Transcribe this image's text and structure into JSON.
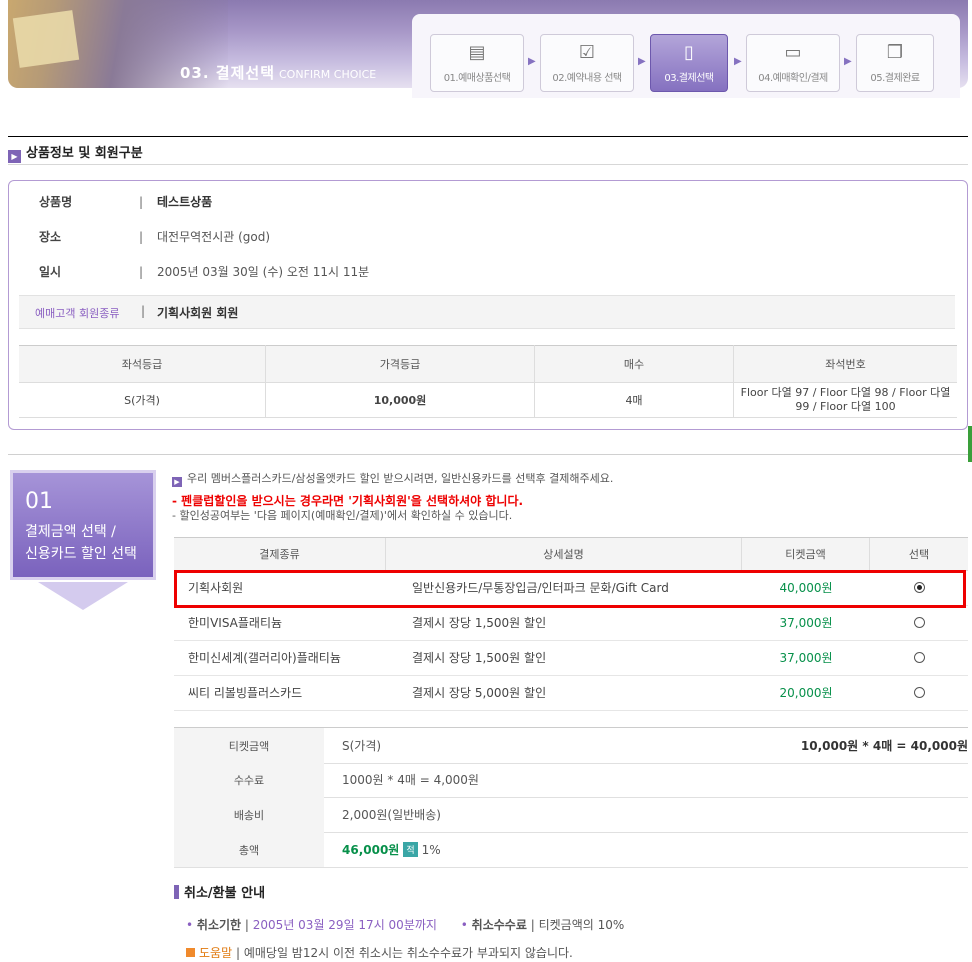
{
  "header": {
    "title": "03. 결제선택",
    "subtitle": "CONFIRM CHOICE",
    "steps": [
      {
        "label": "01.예매상품선택",
        "icon": "doc-list-icon"
      },
      {
        "label": "02.예약내용 선택",
        "icon": "checklist-icon"
      },
      {
        "label": "03.결제선택",
        "icon": "phone-icon"
      },
      {
        "label": "04.예매확인/결제",
        "icon": "card-icon"
      },
      {
        "label": "05.결제완료",
        "icon": "gift-icon"
      }
    ]
  },
  "product_section": {
    "title": "상품정보 및 회원구분",
    "fields": [
      {
        "key": "상품명",
        "value": "테스트상품"
      },
      {
        "key": "장소",
        "value": "대전무역전시관 (god)"
      },
      {
        "key": "일시",
        "value": "2005년 03월 30일 (수) 오전 11시 11분"
      }
    ],
    "member_label": "예매고객 회원종류",
    "member_value": "기획사회원 회원",
    "seat_table": {
      "headers": [
        "좌석등급",
        "가격등급",
        "매수",
        "좌석번호"
      ],
      "row": [
        "S(가격)",
        "10,000원",
        "4매",
        "Floor 다열 97 / Floor 다열 98 / Floor 다열 99 / Floor 다열 100"
      ]
    }
  },
  "payment_section": {
    "badge": {
      "num": "01",
      "line1": "결제금액 선택 /",
      "line2": "신용카드 할인 선택"
    },
    "notice1": "우리 멤버스플러스카드/삼성올앳카드 할인 받으시려면, 일반신용카드를 선택후 결제해주세요.",
    "notice2": "- 펜클럽할인을 받으시는 경우라면 '기획사회원'을 선택하셔야 합니다.",
    "notice3": "- 할인성공여부는 '다음 페이지(예매확인/결제)'에서 확인하실 수 있습니다.",
    "headers": [
      "결제종류",
      "상세설명",
      "티켓금액",
      "선택"
    ],
    "rows": [
      {
        "type": "기획사회원",
        "desc": "일반신용카드/무통장입금/인터파크 문화/Gift Card",
        "amount": "40,000원",
        "selected": true
      },
      {
        "type": "한미VISA플래티늄",
        "desc": "결제시 장당 1,500원 할인",
        "amount": "37,000원",
        "selected": false
      },
      {
        "type": "한미신세계(갤러리아)플래티늄",
        "desc": "결제시 장당 1,500원 할인",
        "amount": "37,000원",
        "selected": false
      },
      {
        "type": "씨티 리볼빙플러스카드",
        "desc": "결제시 장당 5,000원 할인",
        "amount": "20,000원",
        "selected": false
      }
    ]
  },
  "summary": {
    "ticket_label": "티켓금액",
    "ticket_value": "S(가격)",
    "ticket_calc": "10,000원 * 4매 = 40,000원",
    "fee_label": "수수료",
    "fee_value": "1000원 * 4매 = 4,000원",
    "delivery_label": "배송비",
    "delivery_value": "2,000원(일반배송)",
    "total_label": "총액",
    "total_value": "46,000원",
    "point_badge": "적",
    "point_value": "1%"
  },
  "cancel": {
    "title": "취소/환불 안내",
    "deadline_label": "취소기한",
    "deadline_value": "2005년 03월 29일 17시 00분까지",
    "fee_label": "취소수수료",
    "fee_value": "티켓금액의 10%",
    "help_label": "도움말",
    "help_value": "예매당일 밤12시 이전 취소시는 취소수수료가 부과되지 않습니다."
  },
  "colors": {
    "accent": "#7e64b6",
    "price_green": "#07904a",
    "highlight_red": "#ee0000"
  }
}
